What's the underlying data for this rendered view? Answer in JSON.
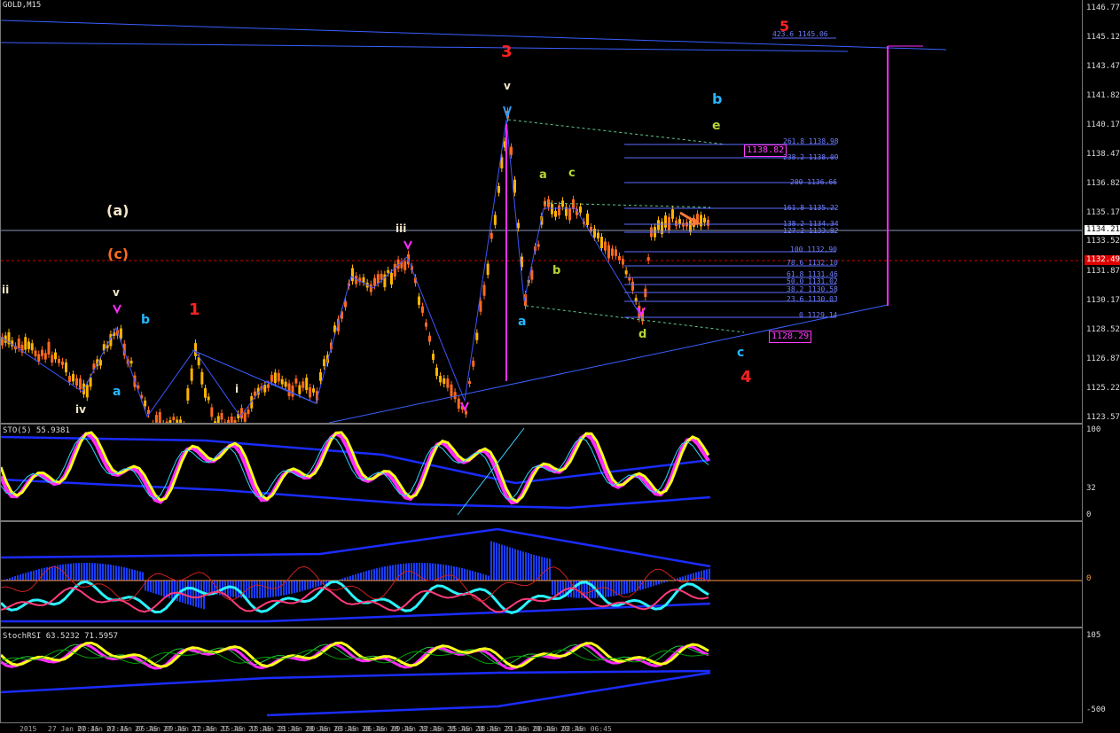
{
  "symbol_title": "GOLD,M15",
  "price_axis": [
    "1146.77",
    "1145.12",
    "1143.47",
    "1141.82",
    "1140.17",
    "1138.47",
    "1136.82",
    "1135.17",
    "1133.52",
    "1131.87",
    "1130.17",
    "1128.52",
    "1126.87",
    "1125.22",
    "1123.57"
  ],
  "current_price_tag": "1134.21",
  "red_price_tag": "1132.49",
  "fib_levels": [
    "423.6 1145.06",
    "261.8 1138.98",
    "238.2 1138.09",
    "200 1136.66",
    "161.8 1135.22",
    "138.2 1134.34",
    "127.2 1133.92",
    "100 1132.90",
    "78.6 1132.10",
    "61.8 1131.46",
    "50.0 1131.02",
    "38.2 1130.58",
    "23.6 1130.03",
    "0 1129.14"
  ],
  "box_labels": {
    "upper": "1138.82",
    "lower": "1128.29"
  },
  "wave_labels": {
    "five": "5",
    "three": "3",
    "v_top": "v",
    "b_blue_top": "b",
    "e": "e",
    "a_up": "a",
    "c": "c",
    "a_paren": "(a)",
    "c_paren": "(c)",
    "iii": "iii",
    "ii": "ii",
    "v_left": "v",
    "b_left": "b",
    "one": "1",
    "b_mid": "b",
    "a_low": "a",
    "i": "i",
    "iv": "iv",
    "a_left": "a",
    "d": "d",
    "c_blue": "c",
    "four": "4"
  },
  "stoch_pane": {
    "title": "STO(5) 55.9381",
    "scale_top": "100",
    "scale_mid": "32",
    "scale_bot": "0"
  },
  "macd_pane": {
    "scale_mid": "0"
  },
  "stochrsi_pane": {
    "title": "StochRSI 63.5232 71.5957",
    "scale_top": "105",
    "scale_bot": "-500"
  },
  "time_axis": [
    "2015",
    "27 Jan 00:45",
    "27 Jan 03:45",
    "27 Jan 06:45",
    "27 Jan 09:45",
    "27 Jan 12:45",
    "27 Jan 15:45",
    "27 Jan 18:45",
    "27 Jan 21:45",
    "28 Jan 00:45",
    "28 Jan 03:45",
    "28 Jan 06:45",
    "28 Jan 09:45",
    "28 Jan 12:45",
    "28 Jan 15:45",
    "28 Jan 18:45",
    "28 Jan 21:45",
    "29 Jan 00:45",
    "29 Jan 03:45",
    "29 Jan 06:45"
  ],
  "colors": {
    "bull": "#ffb400",
    "bear": "#ff6a1f",
    "trend": "#3f55ff",
    "magenta": "#ff2bff",
    "fib": "#5b6cff",
    "stoch_main": "#ffff1a",
    "macd_hist": "#1a3cff"
  }
}
